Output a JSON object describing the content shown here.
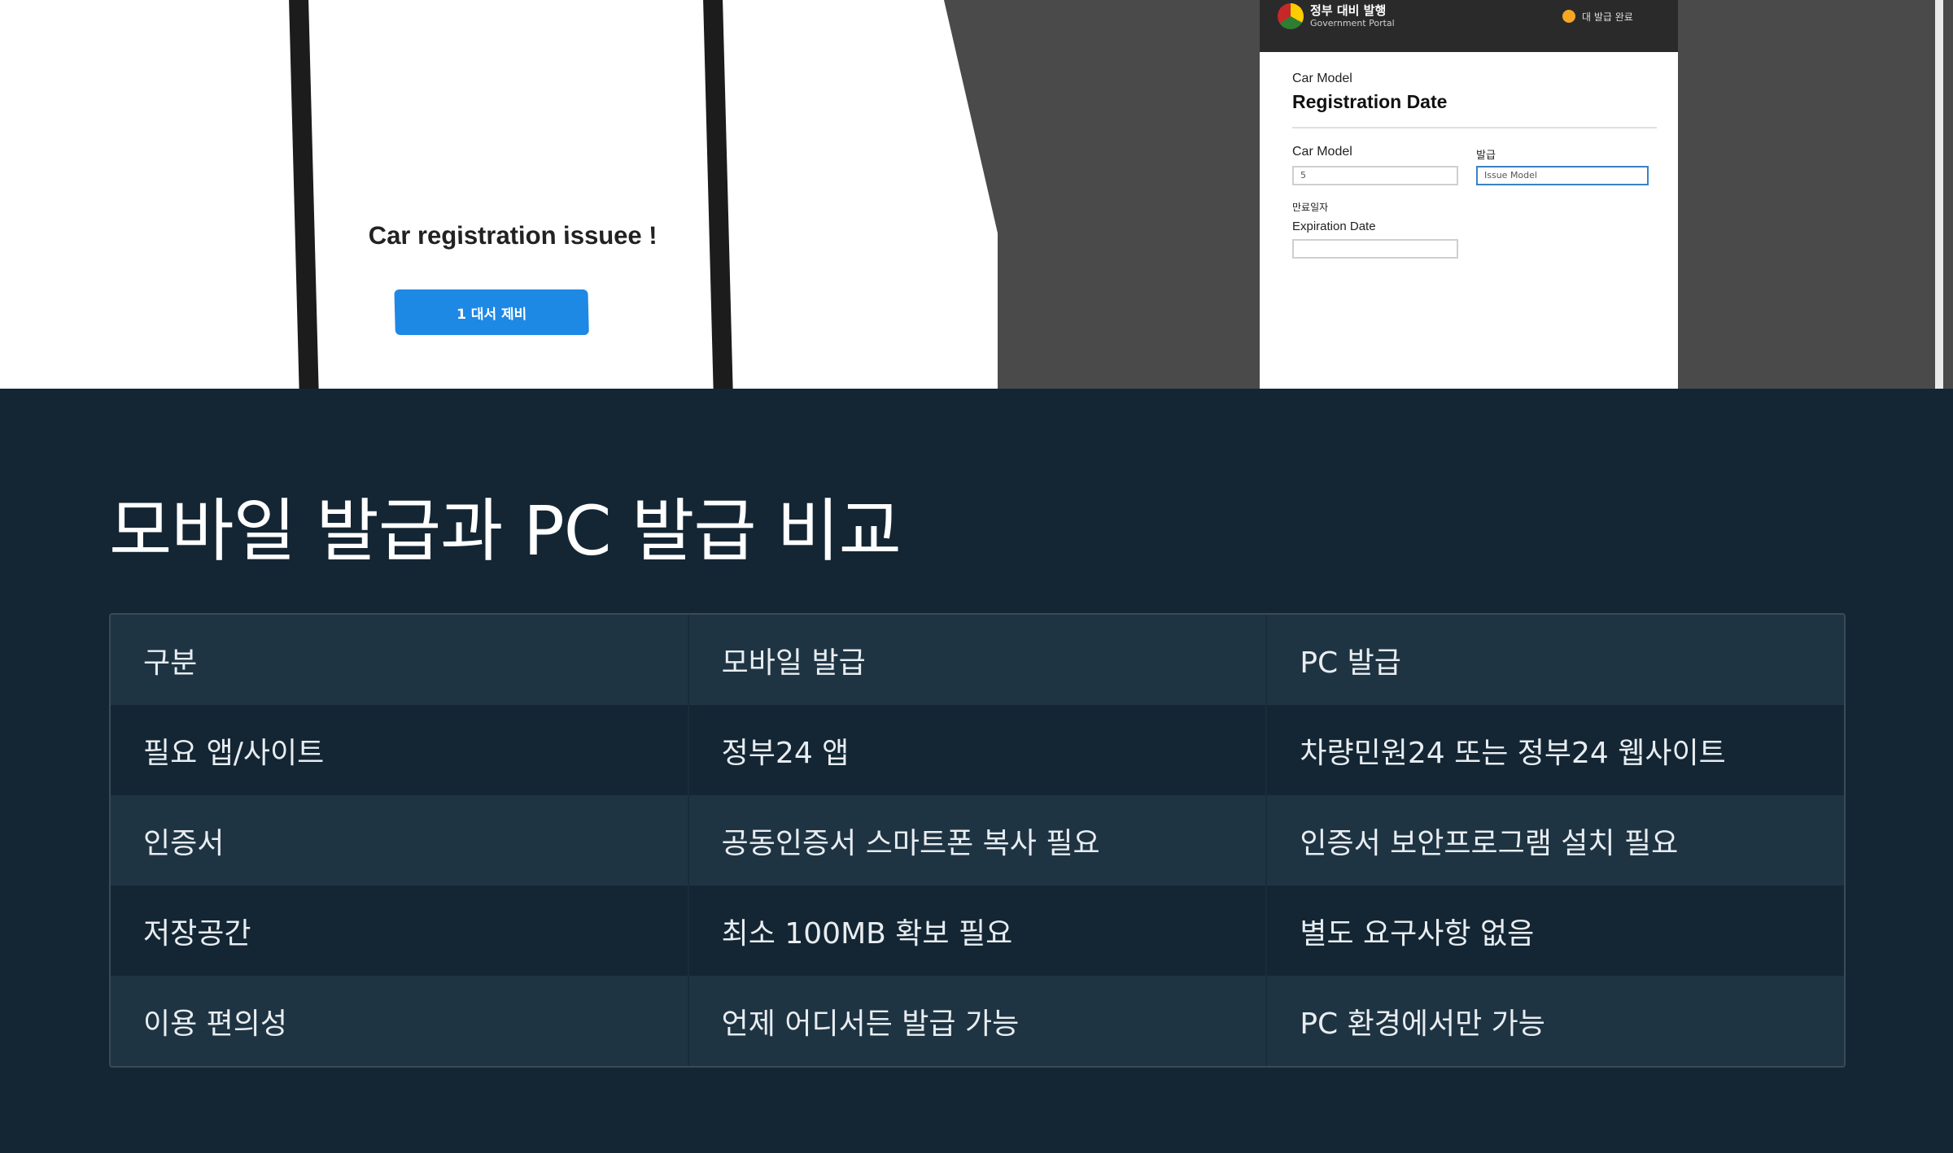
{
  "hero": {
    "phone": {
      "message": "Car registration issuee !",
      "button_label": "1 대서 제비"
    },
    "pc_screen": {
      "brand": "정부 대비 발행",
      "brand_sub": "Government Portal",
      "status": "대 발급 완료",
      "small_label": "Car Model",
      "title": "Registration Date",
      "field1_label": "Car Model",
      "field1_value": "5",
      "field2_label": "발급",
      "field2_value": "Issue Model",
      "field3_label_ko": "만료일자",
      "field3_label": "Expiration Date",
      "field3_value": ""
    }
  },
  "section": {
    "title": "모바일 발급과 PC 발급 비교",
    "table": {
      "headers": [
        "구분",
        "모바일 발급",
        "PC 발급"
      ],
      "rows": [
        [
          "필요 앱/사이트",
          "정부24 앱",
          "차량민원24 또는 정부24 웹사이트"
        ],
        [
          "인증서",
          "공동인증서 스마트폰 복사 필요",
          "인증서 보안프로그램 설치 필요"
        ],
        [
          "저장공간",
          "최소 100MB 확보 필요",
          "별도 요구사항 없음"
        ],
        [
          "이용 편의성",
          "언제 어디서든 발급 가능",
          "PC 환경에서만 가능"
        ]
      ]
    }
  }
}
